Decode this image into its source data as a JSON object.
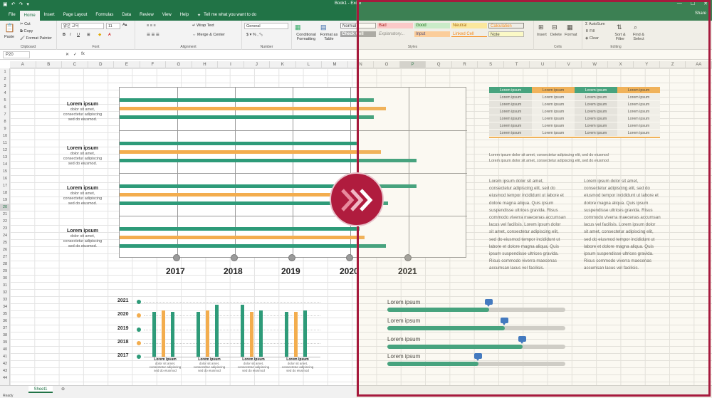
{
  "window": {
    "title": "Book1 - Excel",
    "qat_icons": [
      "excel-icon",
      "save-icon",
      "undo-icon",
      "redo-icon"
    ]
  },
  "tabs": [
    "File",
    "Home",
    "Insert",
    "Page Layout",
    "Formulas",
    "Data",
    "Review",
    "View",
    "Help"
  ],
  "active_tab": "Home",
  "tell_me": "Tell me what you want to do",
  "share": "Share",
  "ribbon": {
    "clipboard": {
      "label": "Clipboard",
      "paste": "Paste",
      "cut": "Cut",
      "copy": "Copy",
      "format_painter": "Format Painter"
    },
    "font": {
      "label": "Font",
      "name": "맑은 고딕",
      "size": "11"
    },
    "alignment": {
      "label": "Alignment",
      "wrap": "Wrap Text",
      "merge": "Merge & Center"
    },
    "number": {
      "label": "Number",
      "format": "General"
    },
    "styles": {
      "label": "Styles",
      "conditional": "Conditional Formatting",
      "format_as_table": "Format as Table",
      "cells": [
        "Normal",
        "Bad",
        "Good",
        "Neutral",
        "Calculation",
        "Check Cell",
        "Explanatory...",
        "Input",
        "Linked Cell",
        "Note"
      ]
    },
    "cells": {
      "label": "Cells",
      "insert": "Insert",
      "delete": "Delete",
      "format": "Format"
    },
    "editing": {
      "label": "Editing",
      "autosum": "AutoSum",
      "fill": "Fill",
      "clear": "Clear",
      "sort": "Sort & Filter",
      "find": "Find & Select"
    }
  },
  "name_box": "P20",
  "columns": [
    "A",
    "B",
    "C",
    "D",
    "E",
    "F",
    "G",
    "H",
    "I",
    "J",
    "K",
    "L",
    "M",
    "N",
    "O",
    "P",
    "Q",
    "R",
    "S",
    "T",
    "U",
    "V",
    "W",
    "X",
    "Y",
    "Z",
    "AA"
  ],
  "rows": [
    "1",
    "2",
    "3",
    "4",
    "5",
    "6",
    "7",
    "8",
    "9",
    "10",
    "11",
    "12",
    "13",
    "14",
    "15",
    "16",
    "17",
    "18",
    "19",
    "20",
    "21",
    "22",
    "23",
    "24",
    "25",
    "26",
    "27",
    "28",
    "29",
    "30",
    "31",
    "32",
    "33",
    "34",
    "35",
    "36",
    "37",
    "38",
    "39",
    "40",
    "41",
    "42",
    "43",
    "44"
  ],
  "selected_row": "20",
  "selected_col": "P",
  "lorem_blocks": [
    {
      "title": "Lorem ipsum",
      "lines": [
        "dolor sit amet,",
        "consectetur adipiscing",
        "sed do eiusmod."
      ]
    },
    {
      "title": "Lorem ipsum",
      "lines": [
        "dolor sit amet,",
        "consectetur adipiscing",
        "sed do eiusmod."
      ]
    },
    {
      "title": "Lorem ipsum",
      "lines": [
        "dolor sit amet,",
        "consectetur adipiscing",
        "sed do eiusmod."
      ]
    },
    {
      "title": "Lorem ipsum",
      "lines": [
        "dolor sit amet,",
        "consectetur adipiscing",
        "sed do eiusmod."
      ]
    }
  ],
  "timeline_years": [
    "2017",
    "2018",
    "2019",
    "2020",
    "2021"
  ],
  "table": {
    "header": [
      "Lorem ipsum",
      "Lorem ipsum",
      "Lorem ipsum",
      "Lorem ipsum"
    ],
    "cell": "Lorem ipsum",
    "rows": 6
  },
  "table_note": [
    "Lorem ipsum dolor sit amet, consectetur adipiscing elit, sed do eiusmod",
    "Lorem ipsum dolor sit amet, consectetur adipiscing elit, sed do eiusmod"
  ],
  "paragraph": "Lorem ipsum dolor sit amet, consectetur adipiscing elit, sed do eiusmod tempor incididunt ut labore et dolore magna aliqua. Quis ipsum suspendisse ultrices gravida. Risus commodo viverra maecenas accumsan lacus vel facilisis. Lorem ipsum dolor sit amet, consectetur adipiscing elit, sed do eiusmod tempor incididunt ut labore et dolore magna aliqua. Quis ipsum suspendisse ultrices gravida. Risus commodo viverra maecenas accumsan lacus vel facilisis.",
  "col_chart_years": [
    "2021",
    "2020",
    "2019",
    "2018",
    "2017"
  ],
  "col_chart_labels": [
    {
      "title": "Lorem ipsum",
      "text": "dolor sit amet, consectetur adipiscing sed do eiusmod"
    },
    {
      "title": "Lorem ipsum",
      "text": "dolor sit amet, consectetur adipiscing sed do eiusmod"
    },
    {
      "title": "Lorem ipsum",
      "text": "dolor sit amet, consectetur adipiscing sed do eiusmod"
    },
    {
      "title": "Lorem ipsum",
      "text": "dolor sit amet, consectetur adipiscing sed do eiusmod"
    }
  ],
  "progress": [
    {
      "label": "Lorem ipsum",
      "value": 0.57
    },
    {
      "label": "Lorem ipsum",
      "value": 0.66
    },
    {
      "label": "Lorem ipsum",
      "value": 0.76
    },
    {
      "label": "Lorem ipsum",
      "value": 0.51
    }
  ],
  "sheet_tab": "Sheet1",
  "status": "Ready",
  "colors": {
    "excel_green": "#217346",
    "teal": "#2e9b79",
    "orange": "#f3ad4e",
    "frame": "#a6193d"
  }
}
